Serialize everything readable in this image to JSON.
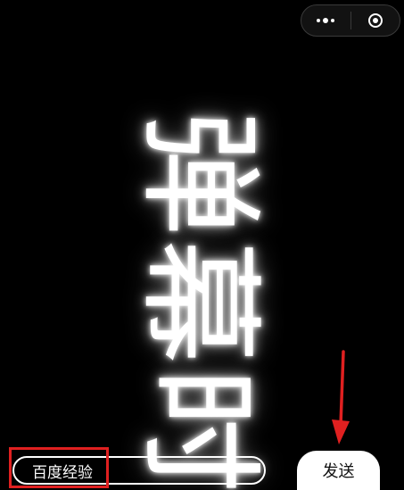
{
  "capsule": {
    "more_icon": "more-dots-icon",
    "close_icon": "target-close-icon"
  },
  "danmaku": {
    "text": "弹幕时"
  },
  "input": {
    "value": "百度经验"
  },
  "send": {
    "label": "发送"
  },
  "annotations": {
    "highlight_color": "#e02020",
    "arrow_color": "#e02020"
  }
}
